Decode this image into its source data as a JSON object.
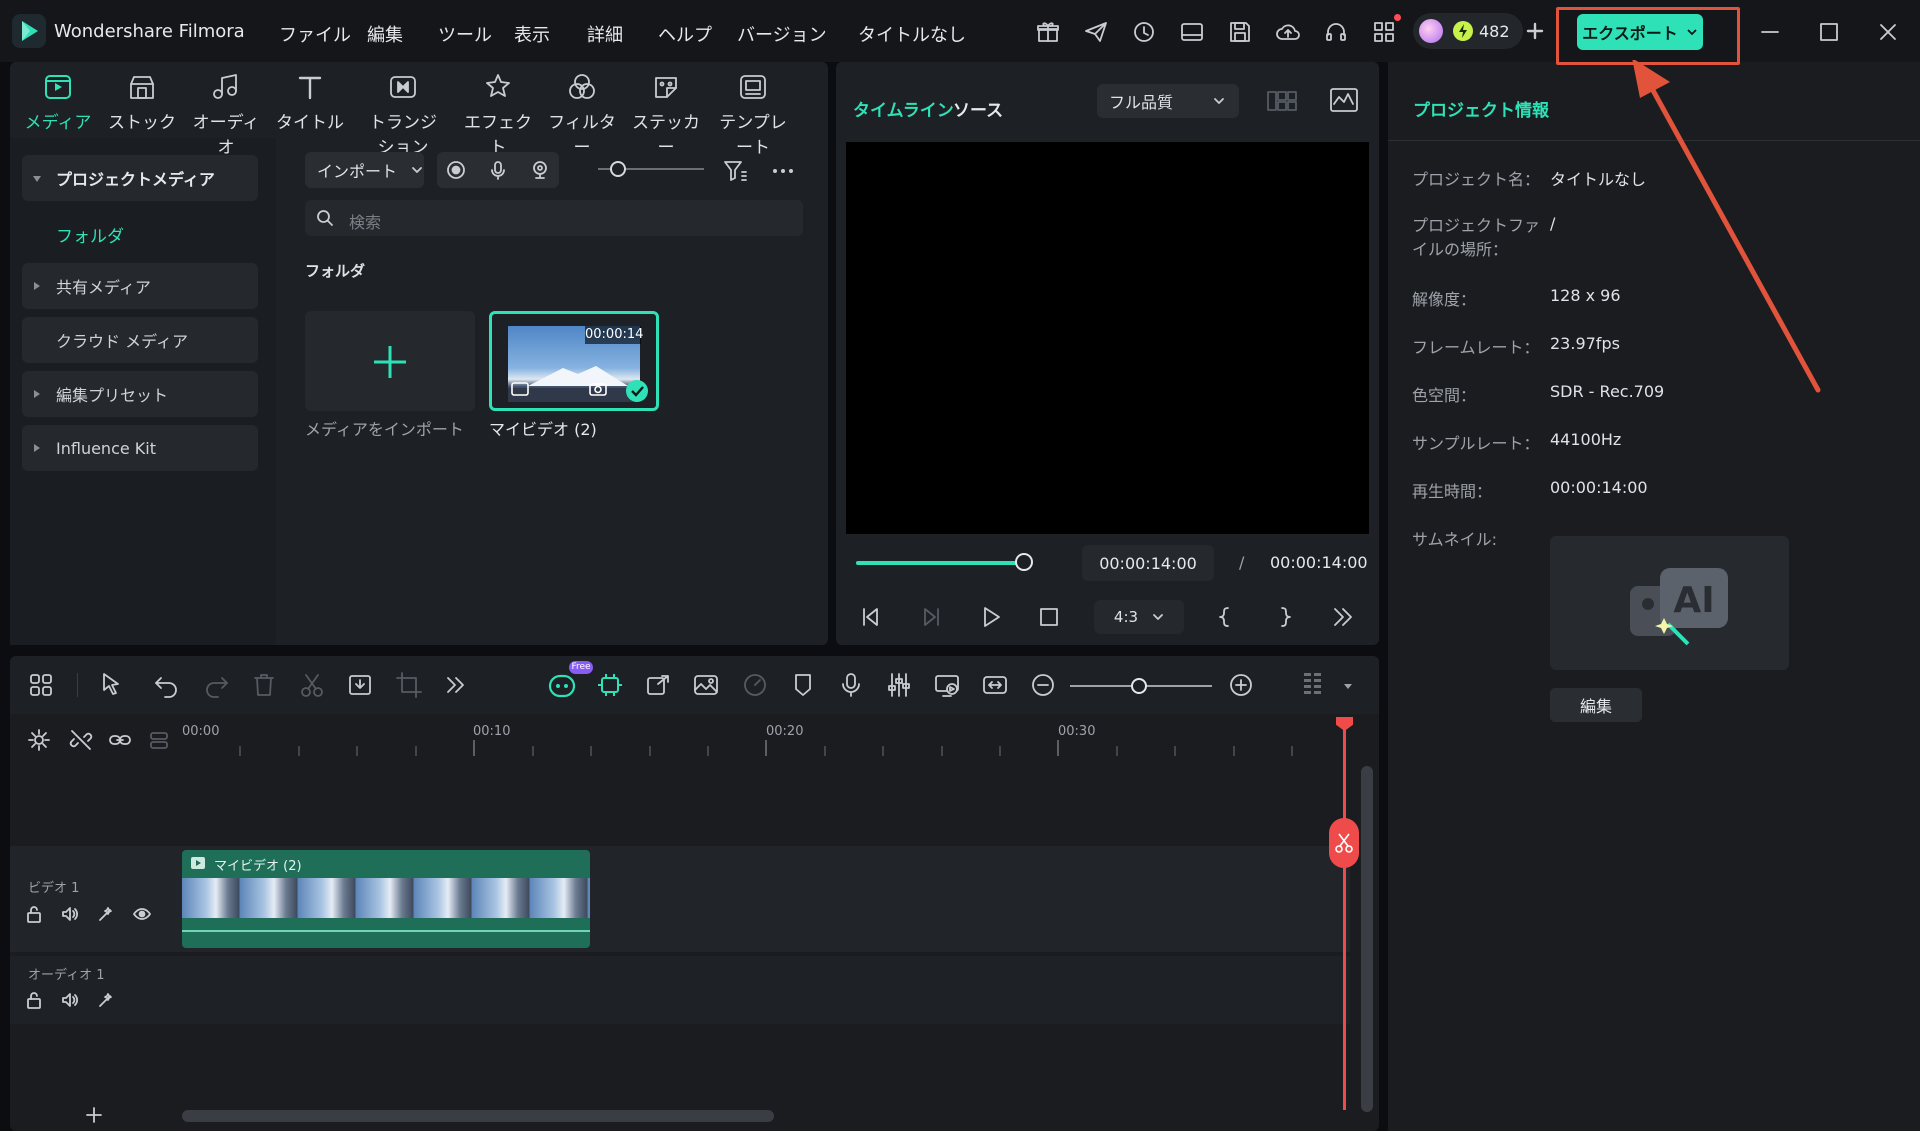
{
  "app": {
    "name": "Wondershare Filmora",
    "project_title": "タイトルなし"
  },
  "menu": [
    "ファイル",
    "編集",
    "ツール",
    "表示",
    "詳細",
    "ヘルプ",
    "バージョン"
  ],
  "credits": {
    "count": "482"
  },
  "export": {
    "label": "エクスポート"
  },
  "tabs": [
    "メディア",
    "ストック",
    "オーディオ",
    "タイトル",
    "トランジション",
    "エフェクト",
    "フィルター",
    "ステッカー",
    "テンプレート"
  ],
  "sidebar": {
    "items": [
      {
        "label": "プロジェクトメディア"
      },
      {
        "label": "フォルダ"
      },
      {
        "label": "共有メディア"
      },
      {
        "label": "クラウド メディア"
      },
      {
        "label": "編集プリセット"
      },
      {
        "label": "Influence Kit"
      }
    ]
  },
  "media": {
    "import_label": "インポート",
    "search_placeholder": "検索",
    "folder_heading": "フォルダ",
    "import_tile_label": "メディアをインポート",
    "clip": {
      "name": "マイビデオ (2)",
      "duration": "00:00:14"
    }
  },
  "preview": {
    "tab_timeline": "タイムライン",
    "tab_source": "ソース",
    "quality": "フル品質",
    "current_time": "00:00:14:00",
    "separator": "/",
    "total_time": "00:00:14:00",
    "aspect": "4:3",
    "progress": 1.0
  },
  "project_info": {
    "title": "プロジェクト情報",
    "rows": [
      {
        "label": "プロジェクト名：",
        "value": "タイトルなし"
      },
      {
        "label": "プロジェクトファ\nイルの場所：",
        "value": "/"
      },
      {
        "label": "解像度：",
        "value": "128 x 96"
      },
      {
        "label": "フレームレート：",
        "value": "23.97fps"
      },
      {
        "label": "色空間：",
        "value": "SDR - Rec.709"
      },
      {
        "label": "サンプルレート：",
        "value": "44100Hz"
      },
      {
        "label": "再生時間：",
        "value": "00:00:14:00"
      }
    ],
    "thumbnail_label": "サムネイル:",
    "edit_button": "編集"
  },
  "timeline": {
    "free_badge": "Free",
    "ruler_labels": [
      "00:00",
      "00:10",
      "00:20",
      "00:30"
    ],
    "tracks": [
      {
        "label": "ビデオ 1",
        "clip": "マイビデオ (2)"
      },
      {
        "label": "オーディオ 1"
      }
    ]
  },
  "colors": {
    "accent": "#2fe1b6",
    "annotation": "#e2533b",
    "playhead": "#f04b4b"
  }
}
